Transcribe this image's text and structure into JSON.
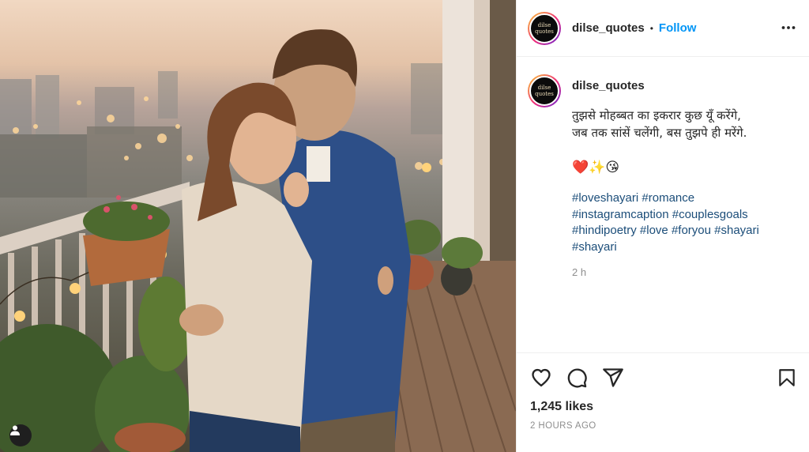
{
  "post": {
    "username": "dilse_quotes",
    "follow_label": "Follow",
    "separator": "•",
    "avatar_text_top": "dilse",
    "avatar_text_bottom": "quotes",
    "caption_line1": "तुझसे मोहब्बत का इकरार कुछ यूँ करेंगे,",
    "caption_line2": "जब तक सांसें चलेंगी, बस तुझपे ही मरेंगे.",
    "caption_emojis": "❤️✨😘",
    "hashtags": [
      "#loveshayari",
      "#romance",
      "#instagramcaption",
      "#couplesgoals",
      "#hindipoetry",
      "#love",
      "#foryou",
      "#shayari",
      "#shayari"
    ],
    "caption_time": "2 h",
    "likes": "1,245 likes",
    "posted_time": "2 HOURS AGO"
  },
  "icons": {
    "more": "more-horizontal-icon",
    "like": "heart-icon",
    "comment": "comment-icon",
    "share": "send-icon",
    "save": "bookmark-icon",
    "photo_tag": "user-tag-icon"
  },
  "colors": {
    "accent": "#0095f6",
    "hashtag": "#1b4d79",
    "muted": "#8e8e8e",
    "text": "#262626"
  }
}
